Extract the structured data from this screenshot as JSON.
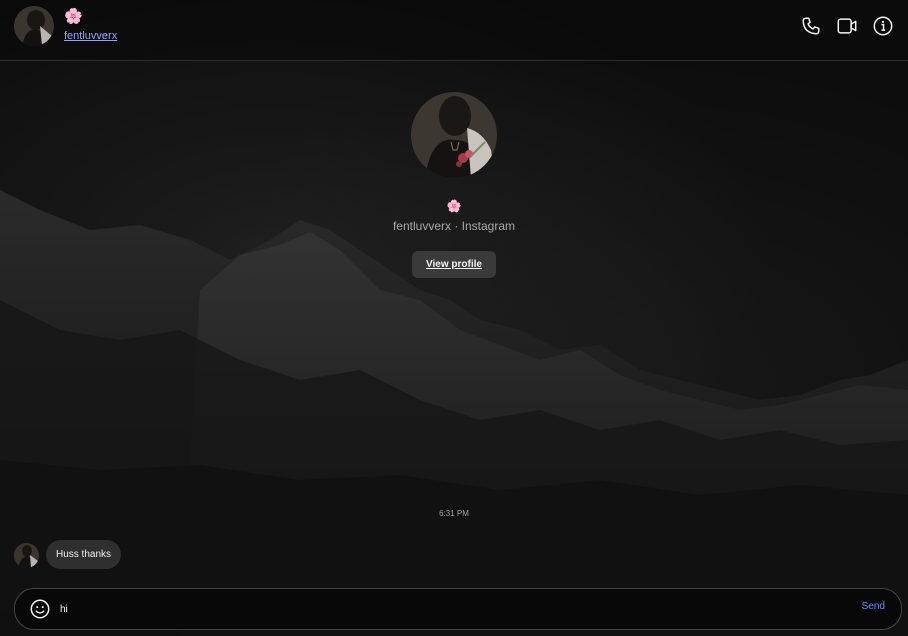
{
  "header": {
    "emoji": "🌸",
    "username": "fentluvverx",
    "icons": [
      "phone-icon",
      "video-camera-icon",
      "info-icon"
    ]
  },
  "profile": {
    "emoji": "🌸",
    "subtitle": "fentluvverx · Instagram",
    "view_profile_label": "View profile"
  },
  "conversation": {
    "timestamp": "6:31 PM",
    "messages": [
      {
        "sender": "them",
        "text": "Huss thanks"
      }
    ]
  },
  "composer": {
    "value": "hi",
    "send_label": "Send",
    "emoji_icon": "smiley-icon"
  },
  "colors": {
    "accent": "#8ea6ff",
    "send": "#6f8cff",
    "bubble": "#2f2f2f",
    "button": "#3a3a3a"
  }
}
